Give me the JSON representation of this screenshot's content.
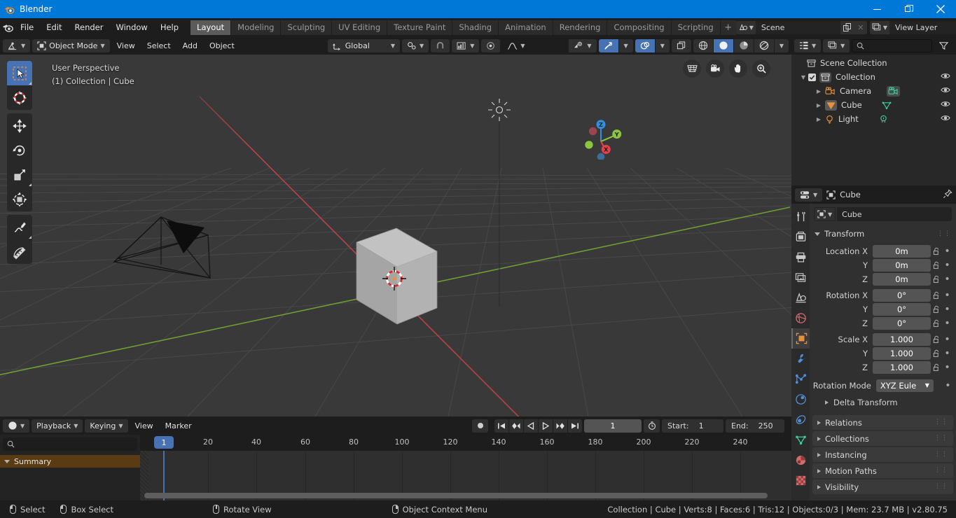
{
  "window": {
    "title": "Blender",
    "app_icon": "blender-logo-icon",
    "minimize": "–",
    "maximize": "❐",
    "close": "✕"
  },
  "topbar": {
    "menus": [
      "File",
      "Edit",
      "Render",
      "Window",
      "Help"
    ],
    "workspaces": [
      {
        "label": "Layout",
        "active": true
      },
      {
        "label": "Modeling",
        "active": false
      },
      {
        "label": "Sculpting",
        "active": false
      },
      {
        "label": "UV Editing",
        "active": false
      },
      {
        "label": "Texture Paint",
        "active": false
      },
      {
        "label": "Shading",
        "active": false
      },
      {
        "label": "Animation",
        "active": false
      },
      {
        "label": "Rendering",
        "active": false
      },
      {
        "label": "Compositing",
        "active": false
      },
      {
        "label": "Scripting",
        "active": false
      }
    ],
    "add_workspace": "+",
    "scene": {
      "label": "Scene",
      "icon": "scene-icon"
    },
    "view_layer": {
      "label": "View Layer",
      "icon": "view-layer-icon"
    }
  },
  "viewport": {
    "header": {
      "editor_type_icon": "editor-type-icon",
      "mode": "Object Mode",
      "menus": [
        "View",
        "Select",
        "Add",
        "Object"
      ],
      "transform_orientation": "Global",
      "orientation_icon": "orientation-icon",
      "snap_icon": "magnet-icon",
      "pivot_icon": "pivot-icon",
      "proportional_icon": "proportional-edit-icon",
      "falloff_icon": "falloff-curve-icon",
      "visibility_icon": "object-visibility-icon",
      "gizmo_icon": "gizmo-icon",
      "overlays_icon": "overlays-icon",
      "xray_icon": "xray-icon",
      "shading_modes": [
        "wireframe",
        "solid",
        "material-preview",
        "rendered"
      ],
      "shading_active_index": 1
    },
    "overlay_text_line1": "User Perspective",
    "overlay_text_line2": "(1) Collection | Cube",
    "tools": [
      {
        "name": "select-box-tool",
        "active": true
      },
      {
        "name": "cursor-tool",
        "active": false
      },
      {
        "name": "move-tool",
        "active": false
      },
      {
        "name": "rotate-tool",
        "active": false
      },
      {
        "name": "scale-tool",
        "active": false
      },
      {
        "name": "transform-tool",
        "active": false
      },
      {
        "name": "annotate-tool",
        "active": false
      },
      {
        "name": "measure-tool",
        "active": false
      }
    ],
    "nav_icons": [
      "camera-perspective-icon",
      "camera-view-icon",
      "pan-view-icon",
      "zoom-view-icon"
    ],
    "gizmo_axes": [
      {
        "label": "Z",
        "color": "#2f8fe0"
      },
      {
        "label": "Y",
        "color": "#8cc63e"
      },
      {
        "label": "X",
        "color": "#e8404a"
      }
    ],
    "bg_color": "#393939",
    "grid_color": "#4a4a4a",
    "axis_x_color": "#c4414a",
    "axis_y_color": "#7eb83f",
    "cube_color": "#b4b4b4"
  },
  "timeline": {
    "editor_icon": "timeline-editor-icon",
    "menus": [
      "Playback",
      "Keying",
      "View",
      "Marker"
    ],
    "record_icon": "auto-keying-icon",
    "playback_buttons": [
      "jump-to-start-icon",
      "jump-to-prev-keyframe-icon",
      "play-reverse-icon",
      "play-icon",
      "jump-to-next-keyframe-icon",
      "jump-to-end-icon"
    ],
    "current_frame": "1",
    "timer_icon": "frame-range-icon",
    "start_label": "Start:",
    "start_value": "1",
    "end_label": "End:",
    "end_value": "250",
    "search_placeholder": "",
    "search_icon": "search-icon",
    "channel_summary": "Summary",
    "ruler_ticks": [
      "20",
      "40",
      "60",
      "80",
      "100",
      "120",
      "140",
      "160",
      "180",
      "200",
      "220",
      "240"
    ],
    "playhead_frame": "1"
  },
  "outliner": {
    "display_mode_icon": "outliner-display-mode-icon",
    "filter_id_icon": "outliner-id-type-icon",
    "search_icon": "search-icon",
    "search_placeholder": "",
    "filter_icon": "filter-icon",
    "rows": [
      {
        "label": "Scene Collection",
        "icon": "scene-collection-icon",
        "indent": 0,
        "eye": false,
        "disclosure": "",
        "checkbox": false
      },
      {
        "label": "Collection",
        "icon": "collection-icon",
        "indent": 1,
        "eye": true,
        "disclosure": "down",
        "checkbox": true
      },
      {
        "label": "Camera",
        "icon": "camera-object-icon",
        "data_icon": "camera-data-icon",
        "indent": 2,
        "eye": true,
        "disclosure": "right",
        "checkbox": false
      },
      {
        "label": "Cube",
        "icon": "mesh-object-icon",
        "data_icon": "mesh-data-icon",
        "indent": 2,
        "eye": true,
        "disclosure": "right",
        "checkbox": false
      },
      {
        "label": "Light",
        "icon": "light-object-icon",
        "data_icon": "light-data-icon",
        "indent": 2,
        "eye": true,
        "disclosure": "right",
        "checkbox": false
      }
    ]
  },
  "properties": {
    "editor_icon": "properties-editor-icon",
    "breadcrumb_icon": "object-icon",
    "breadcrumb": "Cube",
    "pin_icon": "pin-icon",
    "id_icon": "object-icon",
    "id_name": "Cube",
    "tabs": [
      {
        "name": "tool-tab",
        "icon": "tool-icon",
        "active": false,
        "color": "#c9c9c9"
      },
      {
        "name": "render-tab",
        "icon": "render-icon",
        "active": false,
        "color": "#c9c9c9"
      },
      {
        "name": "output-tab",
        "icon": "output-icon",
        "active": false,
        "color": "#c9c9c9"
      },
      {
        "name": "view-layer-tab",
        "icon": "view-layer-icon",
        "active": false,
        "color": "#c9c9c9"
      },
      {
        "name": "scene-tab",
        "icon": "scene-icon",
        "active": false,
        "color": "#c9c9c9"
      },
      {
        "name": "world-tab",
        "icon": "world-icon",
        "active": false,
        "color": "#d66a6a"
      },
      {
        "name": "object-tab",
        "icon": "object-icon",
        "active": true,
        "color": "#e8913a"
      },
      {
        "name": "modifier-tab",
        "icon": "wrench-icon",
        "active": false,
        "color": "#4e8fdd"
      },
      {
        "name": "particles-tab",
        "icon": "particles-icon",
        "active": false,
        "color": "#4e8fdd"
      },
      {
        "name": "physics-tab",
        "icon": "physics-icon",
        "active": false,
        "color": "#4e8fdd"
      },
      {
        "name": "constraints-tab",
        "icon": "constraints-icon",
        "active": false,
        "color": "#4e8fdd"
      },
      {
        "name": "object-data-tab",
        "icon": "mesh-data-icon",
        "active": false,
        "color": "#3ecf9e"
      },
      {
        "name": "material-tab",
        "icon": "material-icon",
        "active": false,
        "color": "#d66a6a"
      },
      {
        "name": "texture-tab",
        "icon": "texture-icon",
        "active": false,
        "color": "#d66a6a"
      }
    ],
    "transform_panel": {
      "title": "Transform",
      "fields": [
        {
          "label": "Location X",
          "value": "0m"
        },
        {
          "label": "Y",
          "value": "0m"
        },
        {
          "label": "Z",
          "value": "0m"
        },
        {
          "label": "Rotation X",
          "value": "0°"
        },
        {
          "label": "Y",
          "value": "0°"
        },
        {
          "label": "Z",
          "value": "0°"
        },
        {
          "label": "Scale X",
          "value": "1.000"
        },
        {
          "label": "Y",
          "value": "1.000"
        },
        {
          "label": "Z",
          "value": "1.000"
        }
      ],
      "rotation_mode_label": "Rotation Mode",
      "rotation_mode_value": "XYZ Eule",
      "delta_transform": "Delta Transform"
    },
    "closed_panels": [
      "Relations",
      "Collections",
      "Instancing",
      "Motion Paths",
      "Visibility"
    ]
  },
  "statusbar": {
    "items": [
      {
        "mouse": "left",
        "label": "Select"
      },
      {
        "mouse": "left-drag",
        "label": "Box Select"
      },
      {
        "mouse": "middle",
        "label": "Rotate View"
      },
      {
        "mouse": "right",
        "label": "Object Context Menu"
      }
    ],
    "stats": "Collection | Cube | Verts:8 | Faces:6 | Tris:12 | Objects:0/3 | Mem: 23.7 MB | v2.80.75"
  }
}
